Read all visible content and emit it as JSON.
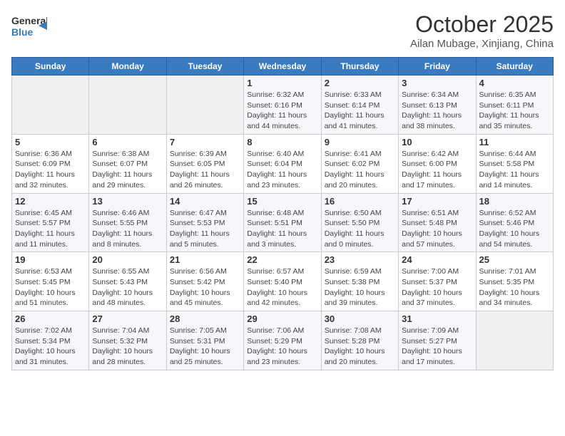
{
  "header": {
    "logo_general": "General",
    "logo_blue": "Blue",
    "month_title": "October 2025",
    "subtitle": "Ailan Mubage, Xinjiang, China"
  },
  "weekdays": [
    "Sunday",
    "Monday",
    "Tuesday",
    "Wednesday",
    "Thursday",
    "Friday",
    "Saturday"
  ],
  "weeks": [
    [
      {
        "day": "",
        "info": ""
      },
      {
        "day": "",
        "info": ""
      },
      {
        "day": "",
        "info": ""
      },
      {
        "day": "1",
        "info": "Sunrise: 6:32 AM\nSunset: 6:16 PM\nDaylight: 11 hours and 44 minutes."
      },
      {
        "day": "2",
        "info": "Sunrise: 6:33 AM\nSunset: 6:14 PM\nDaylight: 11 hours and 41 minutes."
      },
      {
        "day": "3",
        "info": "Sunrise: 6:34 AM\nSunset: 6:13 PM\nDaylight: 11 hours and 38 minutes."
      },
      {
        "day": "4",
        "info": "Sunrise: 6:35 AM\nSunset: 6:11 PM\nDaylight: 11 hours and 35 minutes."
      }
    ],
    [
      {
        "day": "5",
        "info": "Sunrise: 6:36 AM\nSunset: 6:09 PM\nDaylight: 11 hours and 32 minutes."
      },
      {
        "day": "6",
        "info": "Sunrise: 6:38 AM\nSunset: 6:07 PM\nDaylight: 11 hours and 29 minutes."
      },
      {
        "day": "7",
        "info": "Sunrise: 6:39 AM\nSunset: 6:05 PM\nDaylight: 11 hours and 26 minutes."
      },
      {
        "day": "8",
        "info": "Sunrise: 6:40 AM\nSunset: 6:04 PM\nDaylight: 11 hours and 23 minutes."
      },
      {
        "day": "9",
        "info": "Sunrise: 6:41 AM\nSunset: 6:02 PM\nDaylight: 11 hours and 20 minutes."
      },
      {
        "day": "10",
        "info": "Sunrise: 6:42 AM\nSunset: 6:00 PM\nDaylight: 11 hours and 17 minutes."
      },
      {
        "day": "11",
        "info": "Sunrise: 6:44 AM\nSunset: 5:58 PM\nDaylight: 11 hours and 14 minutes."
      }
    ],
    [
      {
        "day": "12",
        "info": "Sunrise: 6:45 AM\nSunset: 5:57 PM\nDaylight: 11 hours and 11 minutes."
      },
      {
        "day": "13",
        "info": "Sunrise: 6:46 AM\nSunset: 5:55 PM\nDaylight: 11 hours and 8 minutes."
      },
      {
        "day": "14",
        "info": "Sunrise: 6:47 AM\nSunset: 5:53 PM\nDaylight: 11 hours and 5 minutes."
      },
      {
        "day": "15",
        "info": "Sunrise: 6:48 AM\nSunset: 5:51 PM\nDaylight: 11 hours and 3 minutes."
      },
      {
        "day": "16",
        "info": "Sunrise: 6:50 AM\nSunset: 5:50 PM\nDaylight: 11 hours and 0 minutes."
      },
      {
        "day": "17",
        "info": "Sunrise: 6:51 AM\nSunset: 5:48 PM\nDaylight: 10 hours and 57 minutes."
      },
      {
        "day": "18",
        "info": "Sunrise: 6:52 AM\nSunset: 5:46 PM\nDaylight: 10 hours and 54 minutes."
      }
    ],
    [
      {
        "day": "19",
        "info": "Sunrise: 6:53 AM\nSunset: 5:45 PM\nDaylight: 10 hours and 51 minutes."
      },
      {
        "day": "20",
        "info": "Sunrise: 6:55 AM\nSunset: 5:43 PM\nDaylight: 10 hours and 48 minutes."
      },
      {
        "day": "21",
        "info": "Sunrise: 6:56 AM\nSunset: 5:42 PM\nDaylight: 10 hours and 45 minutes."
      },
      {
        "day": "22",
        "info": "Sunrise: 6:57 AM\nSunset: 5:40 PM\nDaylight: 10 hours and 42 minutes."
      },
      {
        "day": "23",
        "info": "Sunrise: 6:59 AM\nSunset: 5:38 PM\nDaylight: 10 hours and 39 minutes."
      },
      {
        "day": "24",
        "info": "Sunrise: 7:00 AM\nSunset: 5:37 PM\nDaylight: 10 hours and 37 minutes."
      },
      {
        "day": "25",
        "info": "Sunrise: 7:01 AM\nSunset: 5:35 PM\nDaylight: 10 hours and 34 minutes."
      }
    ],
    [
      {
        "day": "26",
        "info": "Sunrise: 7:02 AM\nSunset: 5:34 PM\nDaylight: 10 hours and 31 minutes."
      },
      {
        "day": "27",
        "info": "Sunrise: 7:04 AM\nSunset: 5:32 PM\nDaylight: 10 hours and 28 minutes."
      },
      {
        "day": "28",
        "info": "Sunrise: 7:05 AM\nSunset: 5:31 PM\nDaylight: 10 hours and 25 minutes."
      },
      {
        "day": "29",
        "info": "Sunrise: 7:06 AM\nSunset: 5:29 PM\nDaylight: 10 hours and 23 minutes."
      },
      {
        "day": "30",
        "info": "Sunrise: 7:08 AM\nSunset: 5:28 PM\nDaylight: 10 hours and 20 minutes."
      },
      {
        "day": "31",
        "info": "Sunrise: 7:09 AM\nSunset: 5:27 PM\nDaylight: 10 hours and 17 minutes."
      },
      {
        "day": "",
        "info": ""
      }
    ]
  ]
}
